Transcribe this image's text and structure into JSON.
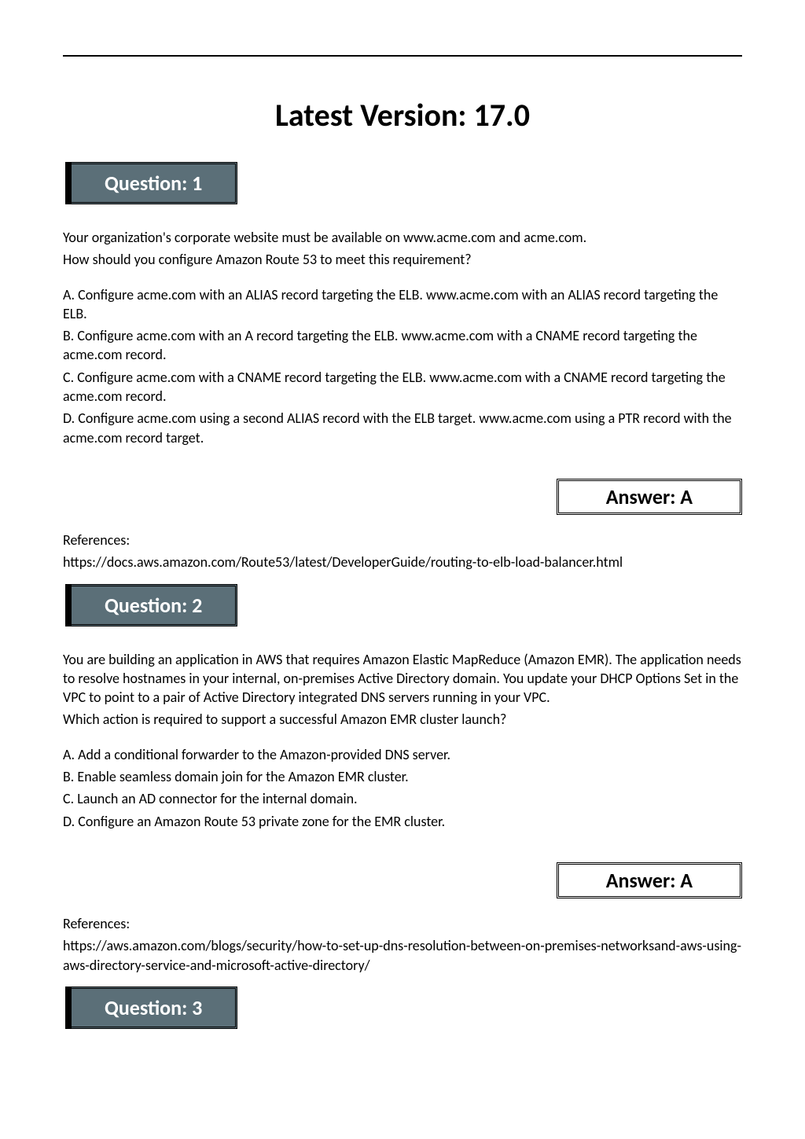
{
  "page": {
    "title": "Latest Version: 17.0"
  },
  "questions": [
    {
      "heading": "Question: 1",
      "intro": [
        "Your organization's corporate website must be available on www.acme.com and acme.com.",
        "How should you configure Amazon Route 53 to meet this requirement?"
      ],
      "options": [
        "A. Configure acme.com with an ALIAS record targeting the ELB. www.acme.com with an ALIAS record targeting the ELB.",
        "B. Configure acme.com with an A record targeting the ELB. www.acme.com with a CNAME record targeting the acme.com record.",
        "C. Configure acme.com with a CNAME record targeting the ELB. www.acme.com with a CNAME record targeting the acme.com record.",
        "D. Configure acme.com using a second ALIAS record with the ELB target. www.acme.com using a PTR record with the acme.com record target."
      ],
      "answer": "Answer: A",
      "references_label": "References:",
      "references": [
        "https://docs.aws.amazon.com/Route53/latest/DeveloperGuide/routing-to-elb-load-balancer.html"
      ]
    },
    {
      "heading": "Question: 2",
      "intro": [
        "You are building an application in AWS that requires Amazon Elastic MapReduce (Amazon EMR). The application needs to resolve hostnames in your internal, on-premises Active Directory domain. You update your DHCP Options Set in the VPC to point to a pair of Active Directory integrated DNS servers running in your VPC.",
        "Which action is required to support a successful Amazon EMR cluster launch?"
      ],
      "options": [
        "A. Add a conditional forwarder to the Amazon-provided DNS server.",
        "B. Enable seamless domain join for the Amazon EMR cluster.",
        "C. Launch an AD connector for the internal domain.",
        "D. Configure an Amazon Route 53 private zone for the EMR cluster."
      ],
      "answer": "Answer: A",
      "references_label": "References:",
      "references": [
        "https://aws.amazon.com/blogs/security/how-to-set-up-dns-resolution-between-on-premises-networksand-aws-using-aws-directory-service-and-microsoft-active-directory/"
      ]
    },
    {
      "heading": "Question: 3"
    }
  ]
}
